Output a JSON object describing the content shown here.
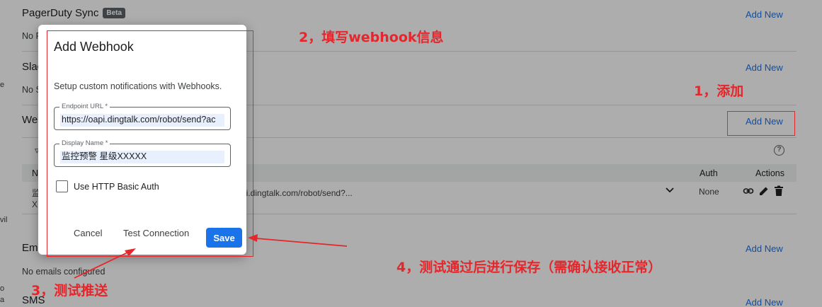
{
  "sections": {
    "pagerduty": {
      "title": "PagerDuty Sync",
      "badge": "Beta",
      "sub": "No F",
      "add": "Add New"
    },
    "slack": {
      "title": "Slac",
      "sub": "No S",
      "add": "Add New"
    },
    "webhooks": {
      "title": "Web",
      "add": "Add New"
    },
    "emails": {
      "title": "Ema",
      "sub": "No emails configured",
      "add": "Add New"
    },
    "sms": {
      "title": "SMS",
      "add": "Add New"
    }
  },
  "table": {
    "columns": {
      "name": "N",
      "auth": "Auth",
      "actions": "Actions"
    },
    "row": {
      "name_line1": "监",
      "name_line2": "X",
      "endpoint": "pi.dingtalk.com/robot/send?...",
      "auth": "None"
    },
    "filter_glyph": "▿",
    "help_glyph": "?"
  },
  "edge_fragments": {
    "e1": "e",
    "e2": "vil",
    "e3": "o",
    "e4": "a"
  },
  "dialog": {
    "title": "Add Webhook",
    "description": "Setup custom notifications with Webhooks.",
    "endpoint_label": "Endpoint URL *",
    "endpoint_value": "https://oapi.dingtalk.com/robot/send?ac",
    "display_label": "Display Name *",
    "display_value": "监控预警 星级XXXXX",
    "checkbox_label": "Use HTTP Basic Auth",
    "cancel": "Cancel",
    "test": "Test Connection",
    "save": "Save"
  },
  "annotations": {
    "step1": "1，添加",
    "step2": "2，填写webhook信息",
    "step3": "3，测试推送",
    "step4": "4，测试通过后进行保存（需确认接收正常）"
  },
  "colors": {
    "annotation": "#e5262b",
    "accent": "#1a73e8",
    "scrim": "rgba(0,0,0,0.32)"
  }
}
